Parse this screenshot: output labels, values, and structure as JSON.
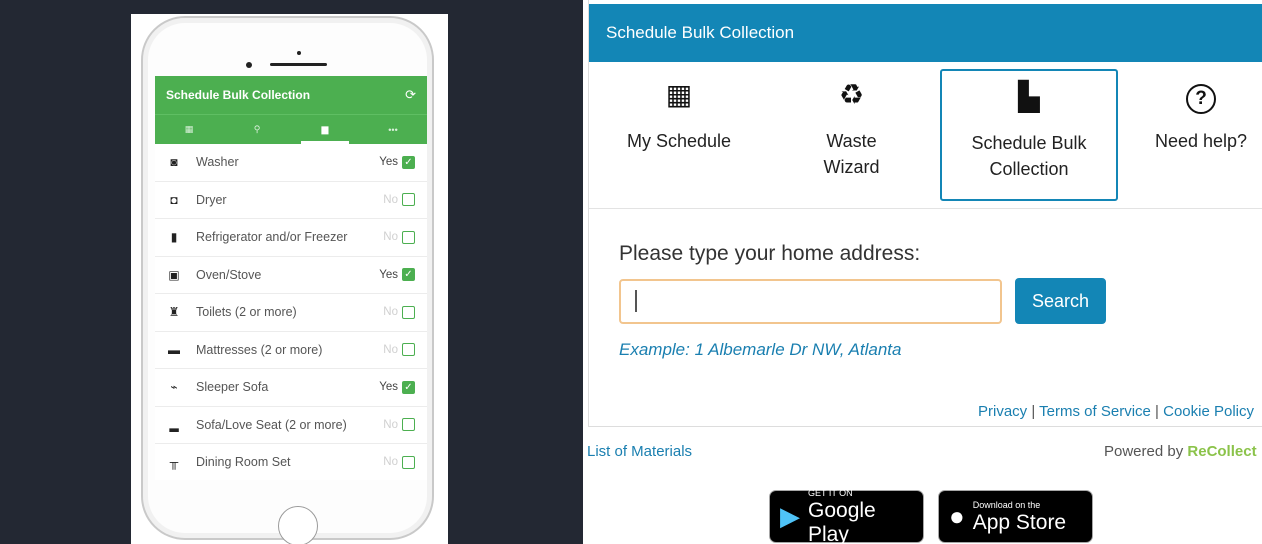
{
  "mobile_app": {
    "header_title": "Schedule Bulk Collection",
    "refresh_icon": "refresh-icon",
    "tabs": [
      {
        "icon": "calendar-icon",
        "glyph": "▦"
      },
      {
        "icon": "search-icon",
        "glyph": "⚲"
      },
      {
        "icon": "armchair-icon",
        "glyph": "▆"
      },
      {
        "icon": "more-icon",
        "glyph": "•••"
      }
    ],
    "items": [
      {
        "label": "Washer",
        "answer": "Yes",
        "checked": true,
        "icon": "washer-icon",
        "glyph": "◙"
      },
      {
        "label": "Dryer",
        "answer": "No",
        "checked": false,
        "icon": "dryer-icon",
        "glyph": "◘"
      },
      {
        "label": "Refrigerator and/or Freezer",
        "answer": "No",
        "checked": false,
        "icon": "refrigerator-icon",
        "glyph": "▮"
      },
      {
        "label": "Oven/Stove",
        "answer": "Yes",
        "checked": true,
        "icon": "oven-icon",
        "glyph": "▣"
      },
      {
        "label": "Toilets (2 or more)",
        "answer": "No",
        "checked": false,
        "icon": "toilet-icon",
        "glyph": "♜"
      },
      {
        "label": "Mattresses (2 or more)",
        "answer": "No",
        "checked": false,
        "icon": "mattress-icon",
        "glyph": "▬"
      },
      {
        "label": "Sleeper Sofa",
        "answer": "Yes",
        "checked": true,
        "icon": "sleeper-sofa-icon",
        "glyph": "⌁"
      },
      {
        "label": "Sofa/Love Seat (2 or more)",
        "answer": "No",
        "checked": false,
        "icon": "sofa-icon",
        "glyph": "▂"
      },
      {
        "label": "Dining Room Set",
        "answer": "No",
        "checked": false,
        "icon": "dining-set-icon",
        "glyph": "╥"
      }
    ]
  },
  "widget": {
    "header_title": "Schedule Bulk Collection",
    "nav": [
      {
        "label": "My Schedule",
        "icon": "calendar-icon",
        "glyph": "▦"
      },
      {
        "label": "Waste Wizard",
        "icon": "recycle-search-icon",
        "glyph": "♻"
      },
      {
        "label": "Schedule Bulk Collection",
        "icon": "armchair-icon",
        "glyph": "▙"
      },
      {
        "label": "Need help?",
        "icon": "help-icon",
        "glyph": "?"
      }
    ],
    "address_label": "Please type your home address:",
    "address_value": "",
    "search_label": "Search",
    "example": "Example: 1 Albemarle Dr NW, Atlanta",
    "footer": {
      "privacy": "Privacy",
      "separator": "|",
      "terms": "Terms of Service",
      "cookie": "Cookie Policy"
    }
  },
  "bottom": {
    "materials_link": "List of Materials",
    "powered_by": "Powered by",
    "brand": "ReCollect",
    "google_small": "GET IT ON",
    "google_big": "Google Play",
    "apple_small": "Download on the",
    "apple_big": "App Store"
  },
  "colors": {
    "app_green": "#4caf50",
    "widget_blue": "#1386b6",
    "dark_background": "#232833",
    "input_border": "#f2c58e"
  }
}
